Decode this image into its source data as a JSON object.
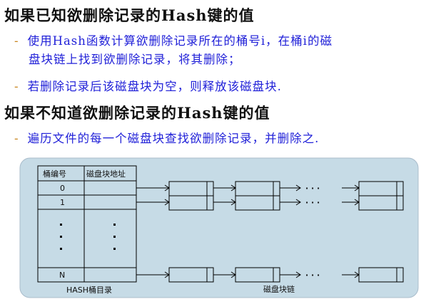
{
  "section1": {
    "heading": "如果已知欲删除记录的Hash键的值",
    "bullets": [
      {
        "dash": "-",
        "line1": "使用Hash函数计算欲删除记录所在的桶号i，在桶i的磁",
        "line2": "盘块链上找到欲删除记录，将其删除；"
      },
      {
        "dash": "-",
        "line1": "若删除记录后该磁盘块为空，则释放该磁盘块."
      }
    ]
  },
  "section2": {
    "heading": "如果不知道欲删除记录的Hash键的值",
    "bullets": [
      {
        "dash": "-",
        "line1": "遍历文件的每一个磁盘块查找欲删除记录，并删除之."
      }
    ]
  },
  "diagram": {
    "table_headers": [
      "桶编号",
      "磁盘块地址"
    ],
    "rows": [
      "0",
      "1",
      "N"
    ],
    "ellipsis": "· · ·",
    "caption_left": "HASH桶目录",
    "caption_right": "磁盘块链",
    "colors": {
      "panel": "#c6dbe6",
      "line": "#000000",
      "text_blue": "#1f1fd8",
      "dash": "#c8851e"
    }
  }
}
